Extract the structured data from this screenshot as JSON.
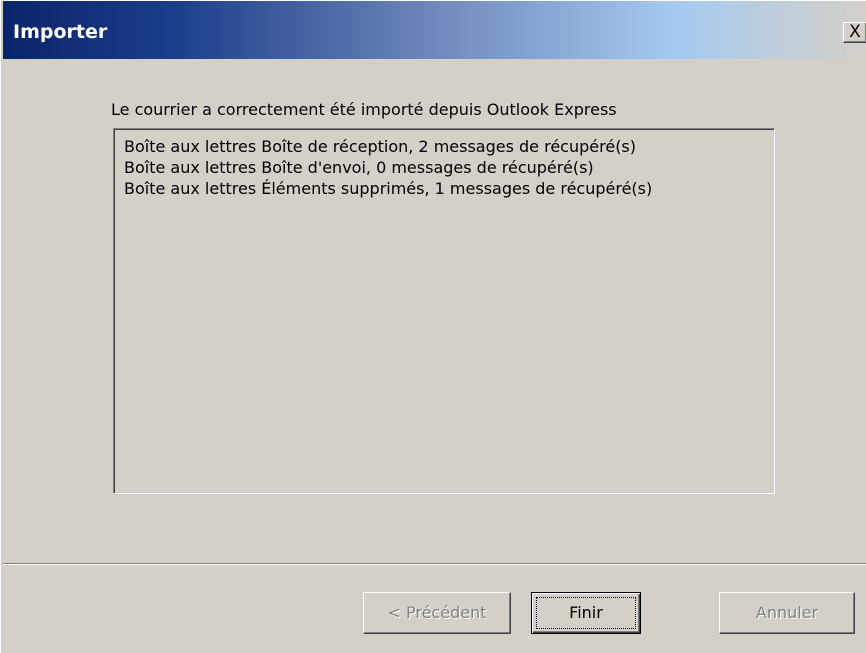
{
  "window": {
    "title": "Importer",
    "close_symbol": "X"
  },
  "main": {
    "message": "Le courrier a correctement été importé depuis Outlook Express",
    "log_lines": [
      "Boîte aux lettres Boîte de réception, 2 messages de récupéré(s)",
      "Boîte aux lettres Boîte d'envoi, 0 messages de récupéré(s)",
      "Boîte aux lettres Éléments supprimés, 1 messages de récupéré(s)"
    ]
  },
  "buttons": {
    "previous": "< Précédent",
    "finish": "Finir",
    "cancel": "Annuler"
  },
  "colors": {
    "title_gradient_start": "#0a246a",
    "title_gradient_end": "#a6caf0",
    "window_background": "#d4d0c8",
    "disabled_text": "#808080"
  },
  "icons": {
    "close": "close-icon"
  }
}
